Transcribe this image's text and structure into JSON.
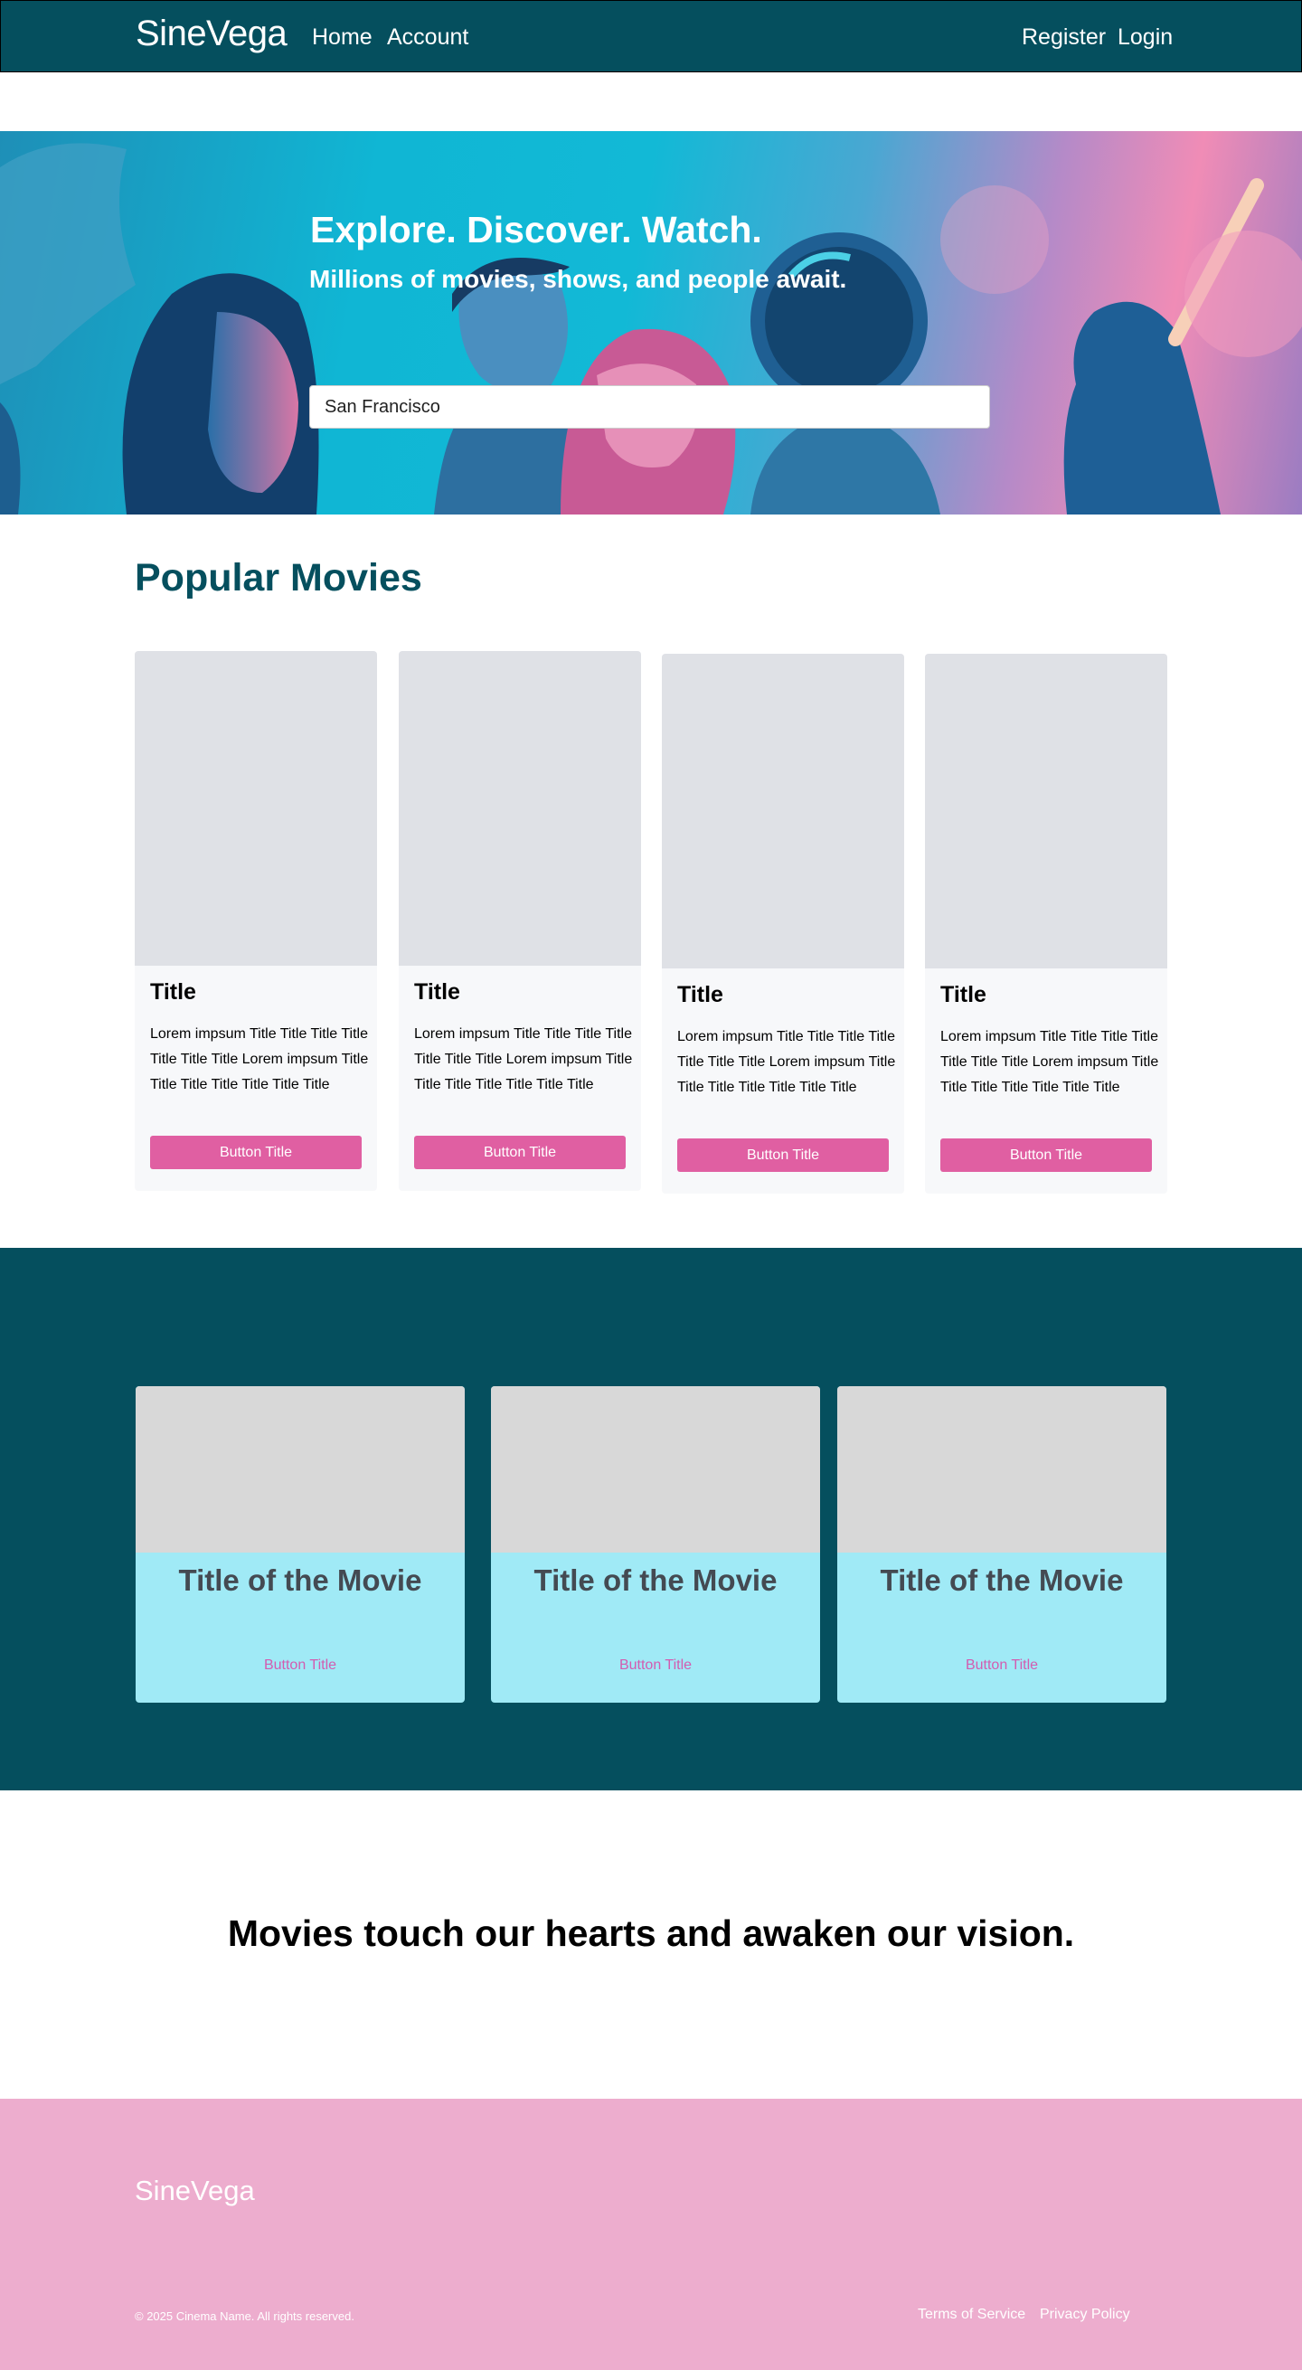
{
  "nav": {
    "brand": "SineVega",
    "links": [
      "Home",
      "Account"
    ],
    "auth": [
      "Register",
      "Login"
    ]
  },
  "hero": {
    "title": "Explore. Discover. Watch.",
    "subtitle": "Millions of movies, shows, and people await.",
    "search_value": "San Francisco"
  },
  "popular": {
    "heading": "Popular Movies",
    "cards": [
      {
        "title": "Title",
        "text": "Lorem impsum Title Title Title Title Title Title Title Lorem impsum Title Title Title Title Title Title Title",
        "button": "Button Title"
      },
      {
        "title": "Title",
        "text": "Lorem impsum Title Title Title Title Title Title Title Lorem impsum Title Title Title Title Title Title Title",
        "button": "Button Title"
      },
      {
        "title": "Title",
        "text": "Lorem impsum Title Title Title Title Title Title Title Lorem impsum Title Title Title Title Title Title Title",
        "button": "Button Title"
      },
      {
        "title": "Title",
        "text": "Lorem impsum Title Title Title Title Title Title Title Lorem impsum Title Title Title Title Title Title Title",
        "button": "Button Title"
      }
    ]
  },
  "featured": {
    "cards": [
      {
        "title": "Title of the Movie",
        "button": "Button Title"
      },
      {
        "title": "Title of the Movie",
        "button": "Button Title"
      },
      {
        "title": "Title of the Movie",
        "button": "Button Title"
      }
    ]
  },
  "quote": "Movies touch our hearts and awaken our vision.",
  "footer": {
    "brand": "SineVega",
    "copyright": "© 2025 Cinema Name. All rights reserved.",
    "links": [
      "Terms of Service",
      "Privacy Policy"
    ]
  },
  "colors": {
    "nav_bg": "#054f5e",
    "accent_pink": "#e05fa2",
    "featured_card": "#a0eaf6",
    "footer_bg": "#edadce"
  }
}
